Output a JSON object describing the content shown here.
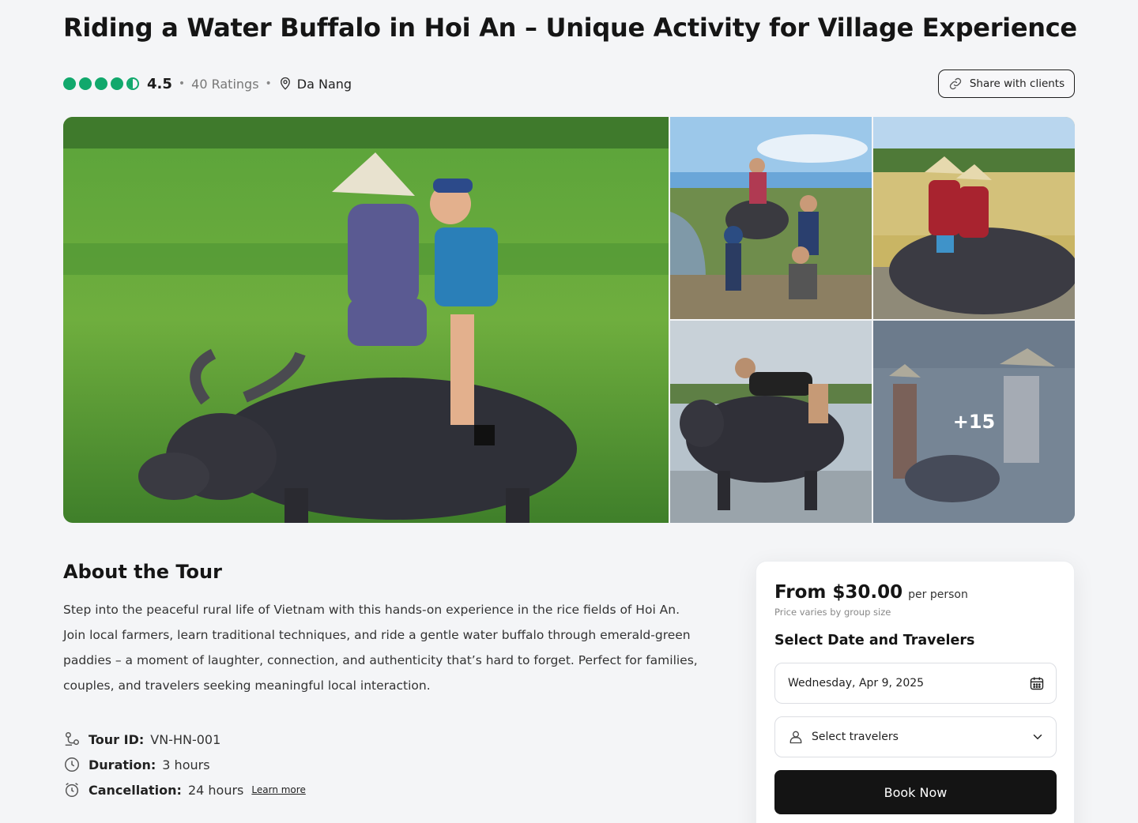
{
  "page": {
    "title": "Riding a Water Buffalo in Hoi An – Unique Activity for Village Experience"
  },
  "meta": {
    "rating": "4.5",
    "rating_value": 4.5,
    "ratings_count": "40 Ratings",
    "separator": "•",
    "location": "Da Nang",
    "star_color": "#11a86c",
    "location_icon": "map-pin-icon",
    "star_icon": "rating-dot-icon"
  },
  "share": {
    "label": "Share with clients",
    "icon": "link-icon"
  },
  "gallery": {
    "more_count": "+15",
    "photos": [
      "main-photo",
      "photo-2",
      "photo-3",
      "photo-4",
      "photo-5"
    ]
  },
  "about": {
    "heading": "About the Tour",
    "body": "Step into the peaceful rural life of Vietnam with this hands-on experience in the rice fields of Hoi An. Join local farmers, learn traditional techniques, and ride a gentle water buffalo through emerald-green paddies – a moment of laughter, connection, and authenticity that’s hard to forget. Perfect for families, couples, and travelers seeking meaningful local interaction."
  },
  "facts": {
    "tour_id_label": "Tour ID:",
    "tour_id": "VN-HN-001",
    "duration_label": "Duration:",
    "duration": "3 hours",
    "cancellation_label": "Cancellation:",
    "cancellation": "24 hours",
    "learn_more": "Learn more"
  },
  "booking": {
    "price": "From $30.00",
    "per": "per person",
    "note": "Price varies by group size",
    "heading": "Select Date and Travelers",
    "date": "Wednesday, Apr 9, 2025",
    "travelers_placeholder": "Select travelers",
    "book_label": "Book Now",
    "button_color": "#141414"
  }
}
